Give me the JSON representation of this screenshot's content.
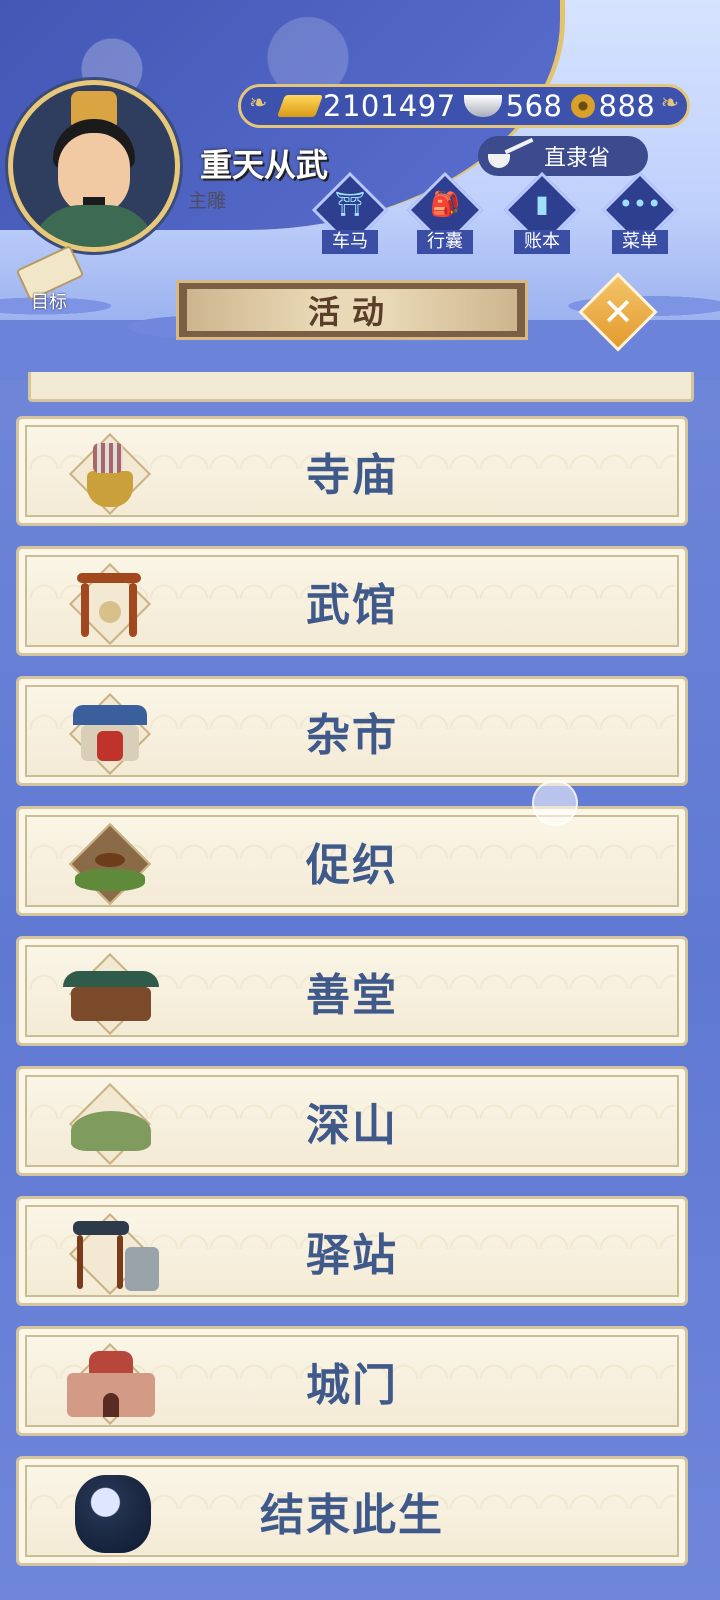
{
  "player": {
    "name": "重天从武",
    "subtitle": "主雕",
    "avatar_icon": "official-portrait-icon"
  },
  "currency": {
    "gold": "2101497",
    "silver": "568",
    "coins": "888"
  },
  "location": {
    "label": "直隶省"
  },
  "menu": [
    {
      "label": "车马",
      "icon": "carriage-icon"
    },
    {
      "label": "行囊",
      "icon": "bag-icon"
    },
    {
      "label": "账本",
      "icon": "ledger-icon"
    },
    {
      "label": "菜单",
      "icon": "more-icon"
    }
  ],
  "target": {
    "label": "目标"
  },
  "title": "活动",
  "close_label": "✕",
  "items": [
    {
      "label": "寺庙",
      "icon": "incense-burner-icon"
    },
    {
      "label": "武馆",
      "icon": "martial-gate-icon"
    },
    {
      "label": "杂市",
      "icon": "market-building-icon"
    },
    {
      "label": "促织",
      "icon": "cricket-icon"
    },
    {
      "label": "善堂",
      "icon": "charity-hall-icon"
    },
    {
      "label": "深山",
      "icon": "mountain-icon"
    },
    {
      "label": "驿站",
      "icon": "post-station-icon"
    },
    {
      "label": "城门",
      "icon": "city-gate-icon"
    },
    {
      "label": "结束此生",
      "icon": "night-lantern-icon"
    }
  ],
  "colors": {
    "accent_gold": "#e3c57b",
    "item_text": "#3f5a8a",
    "panel_bg": "#f3ead4"
  }
}
